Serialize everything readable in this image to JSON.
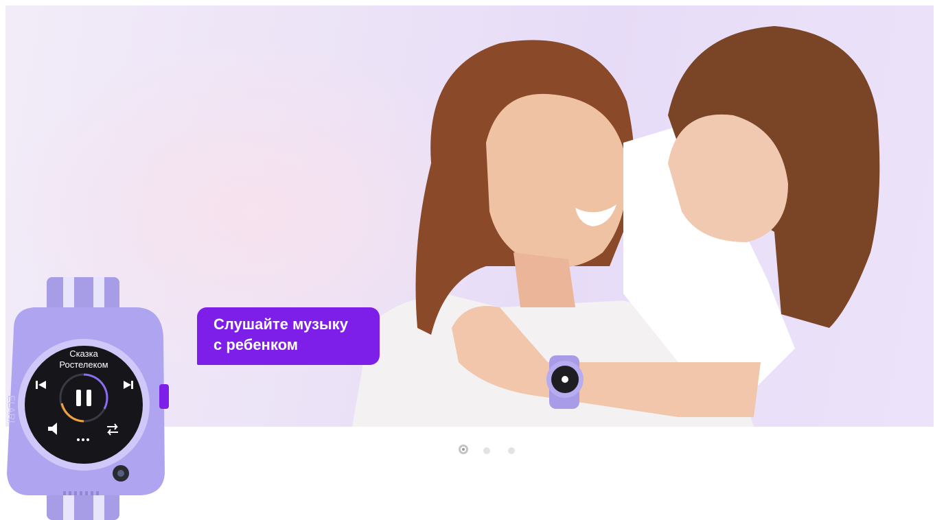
{
  "banner": {
    "promo_line1": "Слушайте музыку",
    "promo_line2": "с ребенком",
    "accent_color": "#7d1fe8"
  },
  "watch": {
    "track_line1": "Сказка",
    "track_line2": "Ростелеком",
    "brand": "ELARI"
  },
  "carousel": {
    "slides": 3,
    "active": 1
  }
}
